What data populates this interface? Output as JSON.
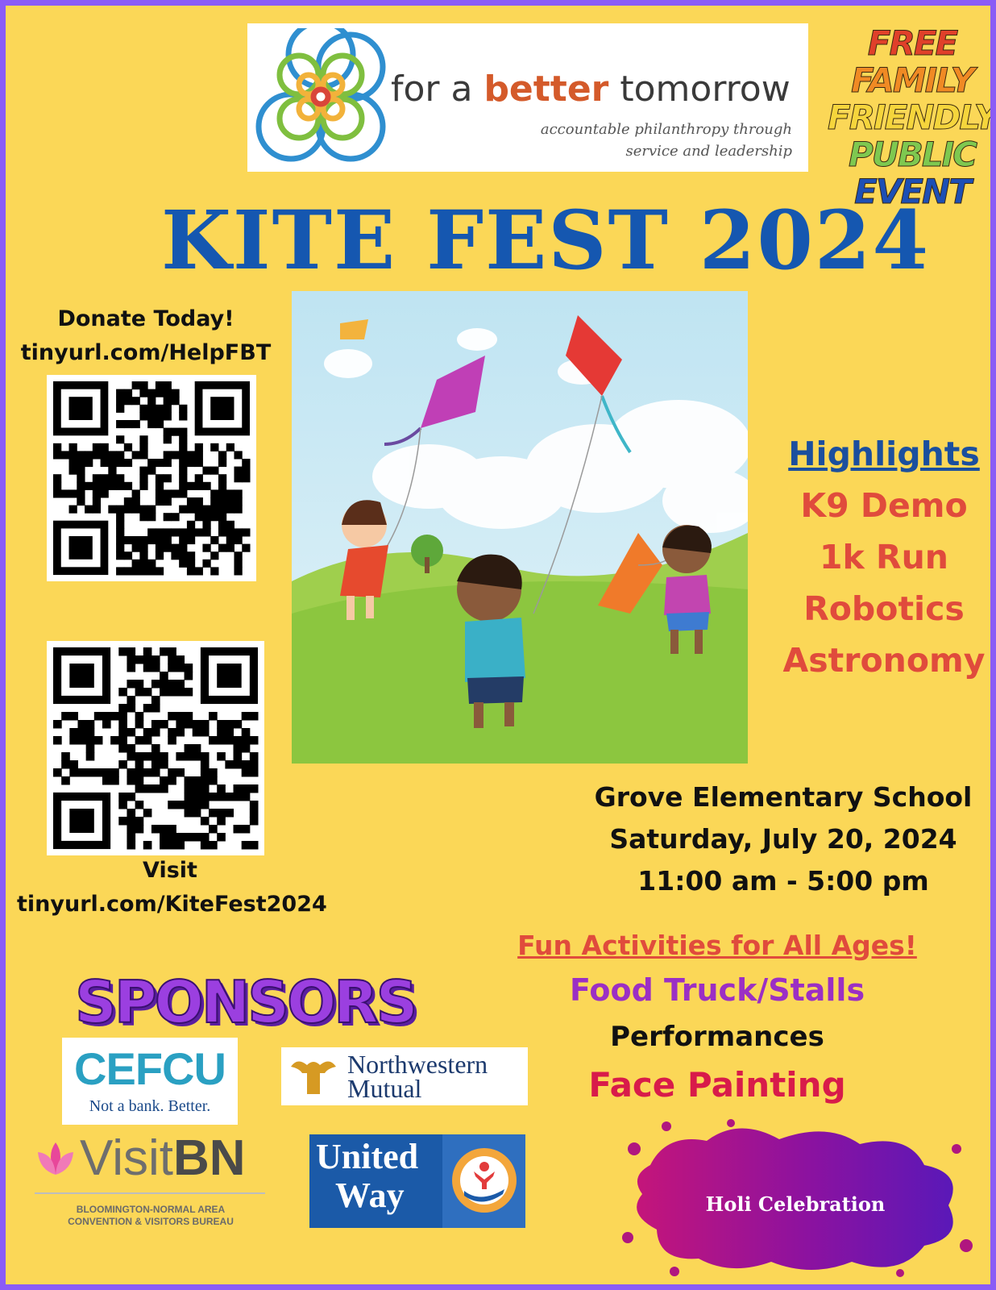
{
  "org": {
    "logo_part1": "for a ",
    "logo_part2": "better",
    "logo_part3": " tomorrow",
    "tagline_line1": "accountable philanthropy through",
    "tagline_line2": "service and leadership"
  },
  "badge": {
    "line1": "FREE",
    "line2": "FAMILY",
    "line3": "FRIENDLY",
    "line4": "PUBLIC",
    "line5": "EVENT",
    "colors": [
      "#e0402a",
      "#f08a24",
      "#f5d53c",
      "#7ec850",
      "#1d4fb5"
    ]
  },
  "title": "KITE FEST 2024",
  "donate": {
    "heading": "Donate Today!",
    "url": "tinyurl.com/HelpFBT"
  },
  "visit": {
    "heading": "Visit",
    "url": "tinyurl.com/KiteFest2024"
  },
  "highlights": {
    "title": "Highlights",
    "items": [
      "K9 Demo",
      "1k Run",
      "Robotics",
      "Astronomy"
    ]
  },
  "venue": {
    "location": "Grove Elementary School",
    "date": "Saturday, July 20, 2024",
    "time": "11:00 am - 5:00 pm"
  },
  "activities": {
    "title": "Fun Activities for All Ages!",
    "items": [
      {
        "label": "Food Truck/Stalls",
        "color": "#9b2fc4"
      },
      {
        "label": "Performances",
        "color": "#111111"
      },
      {
        "label": "Face Painting",
        "color": "#d81b4a"
      }
    ]
  },
  "sponsors": {
    "title": "SPONSORS",
    "cefcu_name": "CEFCU",
    "cefcu_tagline": "Not a bank. Better.",
    "nm_line1": "Northwestern",
    "nm_line2": "Mutual",
    "visitbn_name_a": "Visit",
    "visitbn_name_b": "BN",
    "visitbn_line1": "BLOOMINGTON-NORMAL AREA",
    "visitbn_line2": "CONVENTION & VISITORS BUREAU",
    "uw_line1": "United",
    "uw_line2": "Way"
  },
  "holi": "Holi Celebration",
  "colors": {
    "background": "#fbd757",
    "border": "#8b5cf6",
    "title_blue": "#1557b0",
    "highlight_red": "#e04b3c"
  }
}
